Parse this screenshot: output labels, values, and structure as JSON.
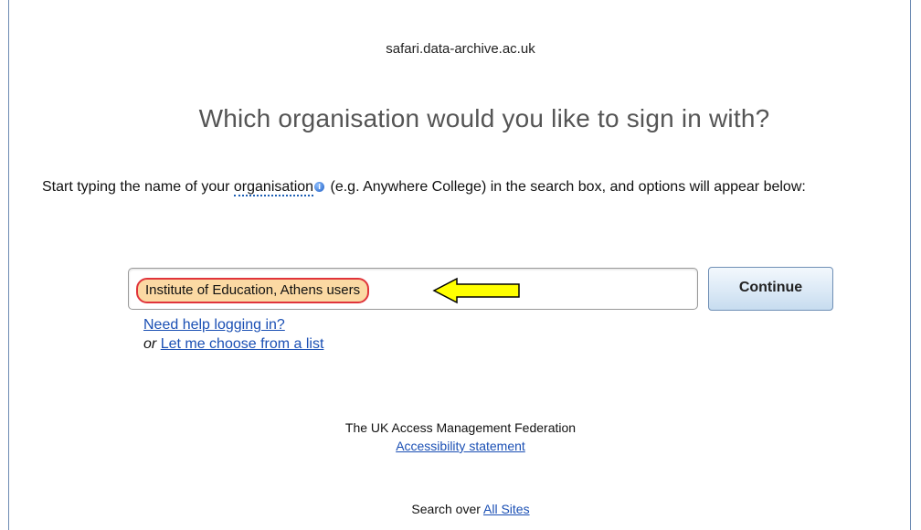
{
  "header": {
    "host": "safari.data-archive.ac.uk",
    "heading": "Which organisation would you like to sign in with?"
  },
  "intro": {
    "before": "Start typing the name of your ",
    "term": "organisation",
    "info_icon": "info-icon",
    "after": " (e.g. Anywhere College) in the search box, and options will appear below:"
  },
  "search": {
    "value": "Institute of Education, Athens users",
    "highlight_color": "#fbd9a3",
    "highlight_border": "#e0343b"
  },
  "annotation": {
    "arrow_icon": "yellow-left-arrow-icon",
    "arrow_color": "#ffff00"
  },
  "buttons": {
    "continue_label": "Continue"
  },
  "help": {
    "need_help_label": "Need help logging in?",
    "or_word": "or",
    "choose_list_label": "Let me choose from a list"
  },
  "footer": {
    "federation_name": "The UK Access Management Federation",
    "accessibility_label": "Accessibility statement",
    "search_over_prefix": "Search over ",
    "all_sites_label": "All Sites"
  }
}
